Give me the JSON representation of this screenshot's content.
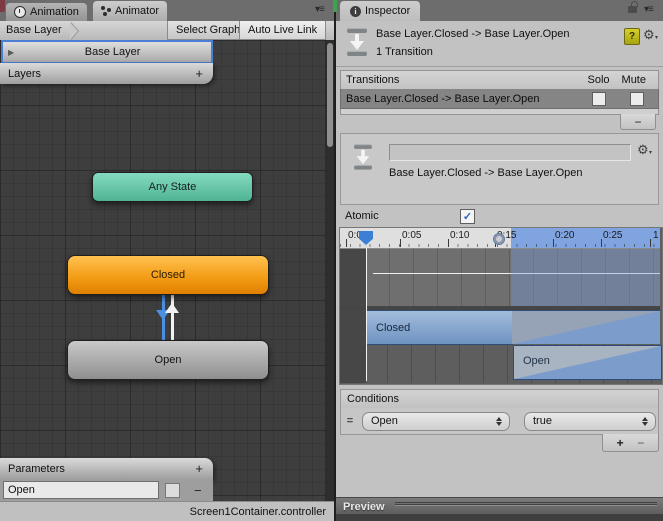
{
  "animator_panel": {
    "tabs": {
      "animation": "Animation",
      "animator": "Animator",
      "pane_menu": "▾≡"
    },
    "toolbar": {
      "breadcrumb": "Base Layer",
      "select_graph_label": "Select Graph",
      "auto_live_link_label": "Auto Live Link"
    },
    "layers": {
      "selected_layer_label": "Base Layer",
      "expander": "▶",
      "panel_label": "Layers",
      "add_label": "+"
    },
    "graph": {
      "nodes": {
        "any_state": "Any State",
        "closed": "Closed",
        "open": "Open"
      }
    },
    "parameters": {
      "panel_label": "Parameters",
      "add_label": "+",
      "param_value": "Open",
      "remove_label": "−"
    },
    "status_bar_text": "Screen1Container.controller"
  },
  "inspector_panel": {
    "tab_label": "Inspector",
    "info_glyph": "i",
    "pane_menu": "▾≡",
    "header": {
      "title": "Base Layer.Closed -> Base Layer.Open",
      "subtitle": "1 Transition",
      "help_label": "?",
      "gear_glyph": "⚙",
      "gear_caret": "▾"
    },
    "transitions": {
      "title": "Transitions",
      "solo_label": "Solo",
      "mute_label": "Mute",
      "row_label": "Base Layer.Closed -> Base Layer.Open",
      "remove_label": "−"
    },
    "detail": {
      "name_field_value": "",
      "caption": "Base Layer.Closed -> Base Layer.Open",
      "gear_glyph": "⚙",
      "gear_caret": "▾"
    },
    "atomic": {
      "label": "Atomic",
      "checked": true
    },
    "timeline": {
      "ticks": [
        "0:00",
        "0:05",
        "0:10",
        "0:15",
        "0:20",
        "0:25",
        "1"
      ],
      "closed_track_label": "Closed",
      "open_track_label": "Open"
    },
    "conditions": {
      "title": "Conditions",
      "handle_label": "=",
      "row": {
        "parameter": "Open",
        "value": "true"
      },
      "add_label": "+",
      "remove_label": "−"
    },
    "preview_label": "Preview"
  },
  "colors": {
    "selection_blue": "#4a7fd4",
    "transition_arrow_blue": "#4a8fe0",
    "node_orange": "#f29a13",
    "node_teal": "#5fc1a1",
    "node_gray": "#aaaaaa",
    "timeline_bar_blue": "#7c9dcb",
    "timeline_ruler_blue": "#7fa4e0",
    "help_icon_yellow": "#c9c417",
    "graph_background": "#3e3e3e",
    "inspector_background": "#c2c2c2"
  }
}
